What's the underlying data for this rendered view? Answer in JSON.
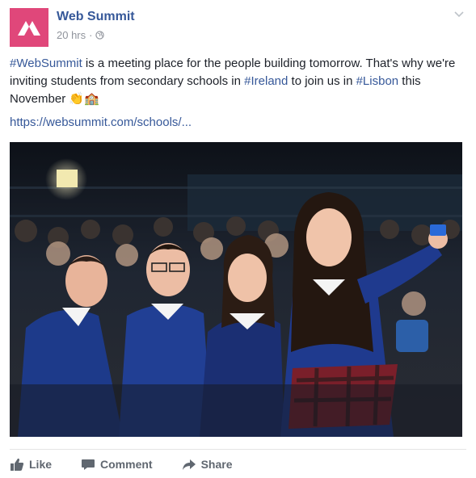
{
  "post": {
    "author": "Web Summit",
    "time": "20 hrs",
    "separator": "·",
    "text": {
      "tag_websummit": "#WebSummit",
      "part1": " is a meeting place for the people building tomorrow. That's why we're inviting students from secondary schools in ",
      "tag_ireland": "#Ireland",
      "part2": " to join us in ",
      "tag_lisbon": "#Lisbon",
      "part3": " this November ",
      "emoji": "👏🏫"
    },
    "link": "https://websummit.com/schools/..."
  },
  "actions": {
    "like": "Like",
    "comment": "Comment",
    "share": "Share"
  },
  "colors": {
    "brand": "#e0477a",
    "link": "#365899",
    "muted": "#90949c",
    "action": "#606770"
  },
  "icons": [
    "web-summit-logo",
    "globe-icon",
    "chevron-down-icon",
    "thumbs-up-icon",
    "comment-icon",
    "share-arrow-icon"
  ]
}
